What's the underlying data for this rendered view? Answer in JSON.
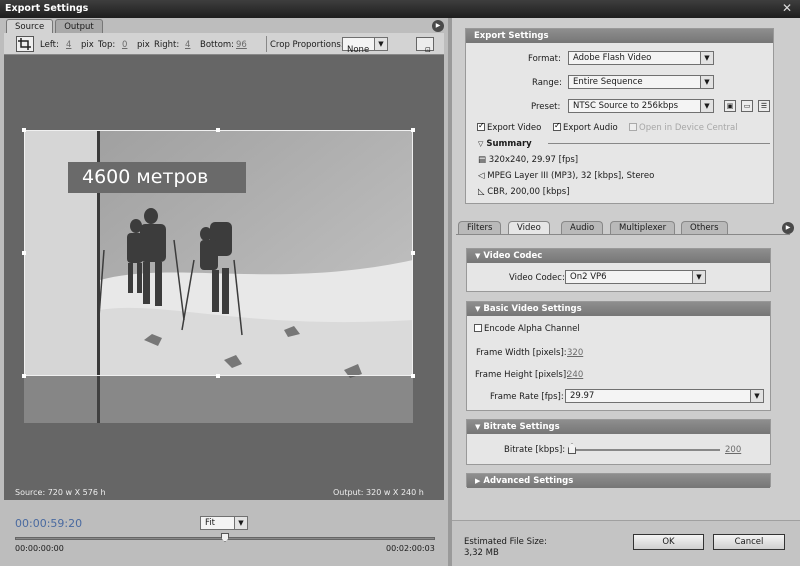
{
  "window": {
    "title": "Export Settings"
  },
  "left": {
    "tabs": [
      "Source",
      "Output"
    ],
    "crop": {
      "left_label": "Left:",
      "left_val": "4",
      "pix1": "pix",
      "top_label": "Top:",
      "top_val": "0",
      "pix2": "pix",
      "right_label": "Right:",
      "right_val": "4",
      "bottom_label": "Bottom:",
      "bottom_val": "96",
      "prop_label": "Crop Proportions:",
      "prop_value": "None"
    },
    "overlay_title": "4600 метров",
    "source_info": "Source: 720 w X 576 h",
    "output_info": "Output: 320 w X 240 h",
    "timecode": "00:00:59:20",
    "zoom": "Fit",
    "time_start": "00:00:00:00",
    "time_end": "00:02:00:03",
    "playhead_fraction": 0.5
  },
  "export": {
    "header": "Export Settings",
    "format_label": "Format:",
    "format_value": "Adobe Flash Video",
    "range_label": "Range:",
    "range_value": "Entire Sequence",
    "preset_label": "Preset:",
    "preset_value": "NTSC Source to 256kbps",
    "export_video": "Export Video",
    "export_audio": "Export Audio",
    "open_device": "Open in Device Central",
    "summary_label": "Summary",
    "summary": [
      "320x240, 29.97 [fps]",
      "MPEG Layer III (MP3), 32 [kbps], Stereo",
      "CBR, 200,00 [kbps]"
    ]
  },
  "tabs": [
    "Filters",
    "Video",
    "Audio",
    "Multiplexer",
    "Others"
  ],
  "video_codec": {
    "header": "Video Codec",
    "label": "Video Codec:",
    "value": "On2 VP6"
  },
  "basic": {
    "header": "Basic Video Settings",
    "alpha": "Encode Alpha Channel",
    "width_label": "Frame Width [pixels]:",
    "width_val": "320",
    "height_label": "Frame Height [pixels]:",
    "height_val": "240",
    "rate_label": "Frame Rate [fps]:",
    "rate_val": "29.97"
  },
  "bitrate": {
    "header": "Bitrate Settings",
    "label": "Bitrate [kbps]:",
    "value": "200",
    "slider_fraction": 0.0
  },
  "advanced": {
    "header": "Advanced Settings"
  },
  "footer": {
    "estimate_label": "Estimated File Size:",
    "estimate_value": "3,32 MB",
    "ok": "OK",
    "cancel": "Cancel"
  }
}
